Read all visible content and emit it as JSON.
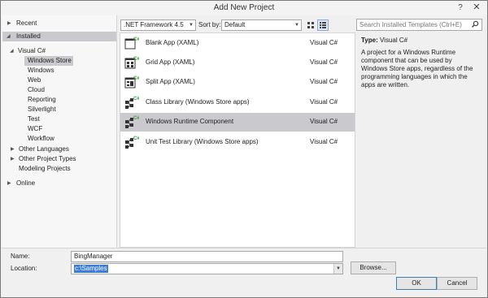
{
  "window": {
    "title": "Add New Project",
    "help": "?",
    "close": "✕"
  },
  "left_tree": {
    "recent": "Recent",
    "installed": "Installed",
    "visual_csharp": "Visual C#",
    "children": [
      "Windows Store",
      "Windows",
      "Web",
      "Cloud",
      "Reporting",
      "Silverlight",
      "Test",
      "WCF",
      "Workflow"
    ],
    "selected_child": "Windows Store",
    "other_languages": "Other Languages",
    "other_project_types": "Other Project Types",
    "modeling_projects": "Modeling Projects",
    "online": "Online"
  },
  "toolbar": {
    "framework": ".NET Framework 4.5",
    "sort_label": "Sort by:",
    "sort_value": "Default"
  },
  "templates": [
    {
      "name": "Blank App (XAML)",
      "lang": "Visual C#",
      "icon": "blank-app-icon"
    },
    {
      "name": "Grid App (XAML)",
      "lang": "Visual C#",
      "icon": "grid-app-icon"
    },
    {
      "name": "Split App (XAML)",
      "lang": "Visual C#",
      "icon": "split-app-icon"
    },
    {
      "name": "Class Library (Windows Store apps)",
      "lang": "Visual C#",
      "icon": "class-library-icon"
    },
    {
      "name": "Windows Runtime Component",
      "lang": "Visual C#",
      "icon": "runtime-component-icon"
    },
    {
      "name": "Unit Test Library (Windows Store apps)",
      "lang": "Visual C#",
      "icon": "unit-test-icon"
    }
  ],
  "selected_template": "Windows Runtime Component",
  "details": {
    "search_placeholder": "Search Installed Templates (Ctrl+E)",
    "type_label": "Type:",
    "type_value": "Visual C#",
    "description": "A project for a Windows Runtime component that can be used by Windows Store apps, regardless of the programming languages in which the apps are written."
  },
  "form": {
    "name_label": "Name:",
    "name_value": "BingManager",
    "location_label": "Location:",
    "location_value": "c:\\Samples",
    "browse": "Browse...",
    "ok": "OK",
    "cancel": "Cancel"
  },
  "colors": {
    "selection": "#c9c9ce",
    "csharp_green": "#3c9a3c",
    "text_highlight": "#3d7dd5"
  }
}
